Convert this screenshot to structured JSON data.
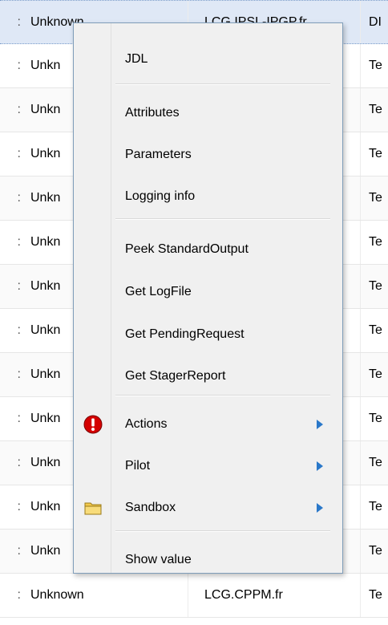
{
  "grid": {
    "rows": [
      {
        "prefix": ":",
        "status": "Unknown",
        "site": "LCG.IPSL-IPGP.fr",
        "last": "DI",
        "selected": true
      },
      {
        "prefix": ":",
        "status": "Unkn",
        "site": "",
        "last": "Te"
      },
      {
        "prefix": ":",
        "status": "Unkn",
        "site": "",
        "last": "Te"
      },
      {
        "prefix": ":",
        "status": "Unkn",
        "site": "",
        "last": "Te"
      },
      {
        "prefix": ":",
        "status": "Unkn",
        "site": "",
        "last": "Te"
      },
      {
        "prefix": ":",
        "status": "Unkn",
        "site": "",
        "last": "Te"
      },
      {
        "prefix": ":",
        "status": "Unkn",
        "site": "",
        "last": "Te"
      },
      {
        "prefix": ":",
        "status": "Unkn",
        "site": "",
        "last": "Te"
      },
      {
        "prefix": ":",
        "status": "Unkn",
        "site": "",
        "last": "Te"
      },
      {
        "prefix": ":",
        "status": "Unkn",
        "site": "",
        "last": "Te"
      },
      {
        "prefix": ":",
        "status": "Unkn",
        "site": "",
        "last": "Te"
      },
      {
        "prefix": ":",
        "status": "Unkn",
        "site": "",
        "last": "Te"
      },
      {
        "prefix": ":",
        "status": "Unkn",
        "site": "",
        "last": "Te"
      },
      {
        "prefix": ":",
        "status": "Unknown",
        "site": "LCG.CPPM.fr",
        "last": "Te"
      }
    ]
  },
  "menu": {
    "jdl": "JDL",
    "attributes": "Attributes",
    "parameters": "Parameters",
    "logging_info": "Logging info",
    "peek_stdout": "Peek StandardOutput",
    "get_logfile": "Get LogFile",
    "get_pending": "Get PendingRequest",
    "get_stager": "Get StagerReport",
    "actions": "Actions",
    "pilot": "Pilot",
    "sandbox": "Sandbox",
    "show_value": "Show value",
    "icons": {
      "actions": "exclamation-icon",
      "sandbox": "folder-icon",
      "submenu": "chevron-right-icon"
    },
    "colors": {
      "arrow": "#2a78c9",
      "alert": "#d40000",
      "folder": "#f2c94c"
    }
  }
}
